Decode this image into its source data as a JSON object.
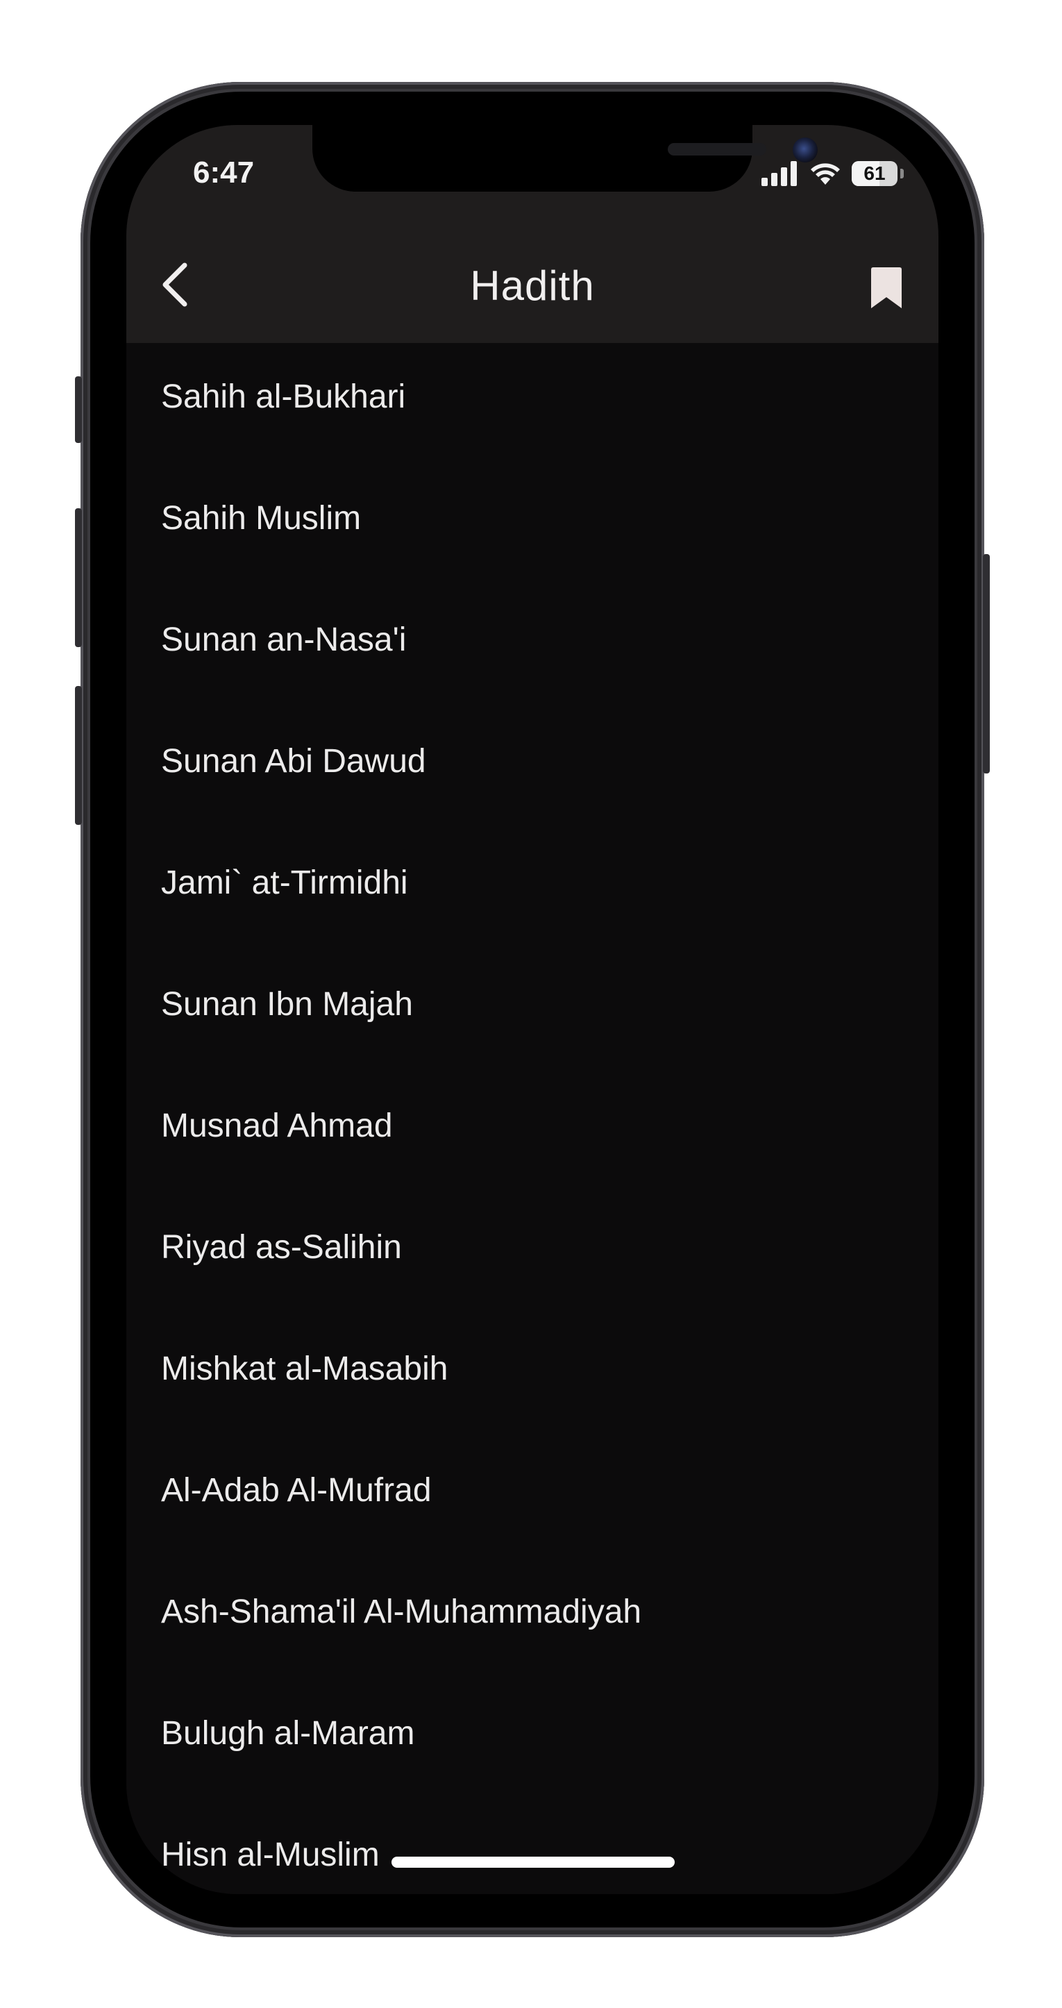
{
  "status_bar": {
    "time": "6:47",
    "battery_level": "61",
    "battery_fraction": 0.61,
    "icons": [
      "cellular-signal-icon",
      "wifi-icon",
      "battery-icon"
    ]
  },
  "nav": {
    "title": "Hadith",
    "back_icon": "chevron-left-icon",
    "bookmark_icon": "bookmark-icon"
  },
  "collections": [
    {
      "label": "Sahih al-Bukhari"
    },
    {
      "label": "Sahih Muslim"
    },
    {
      "label": "Sunan an-Nasa'i"
    },
    {
      "label": "Sunan Abi Dawud"
    },
    {
      "label": "Jami` at-Tirmidhi"
    },
    {
      "label": "Sunan Ibn Majah"
    },
    {
      "label": "Musnad Ahmad"
    },
    {
      "label": "Riyad as-Salihin"
    },
    {
      "label": "Mishkat al-Masabih"
    },
    {
      "label": "Al-Adab Al-Mufrad"
    },
    {
      "label": "Ash-Shama'il Al-Muhammadiyah"
    },
    {
      "label": "Bulugh al-Maram"
    },
    {
      "label": "Hisn al-Muslim"
    }
  ],
  "colors": {
    "header_background": "#1f1d1d",
    "list_background": "#0c0b0c",
    "text": "#ecebeb",
    "bookmark": "#ece3e1"
  }
}
